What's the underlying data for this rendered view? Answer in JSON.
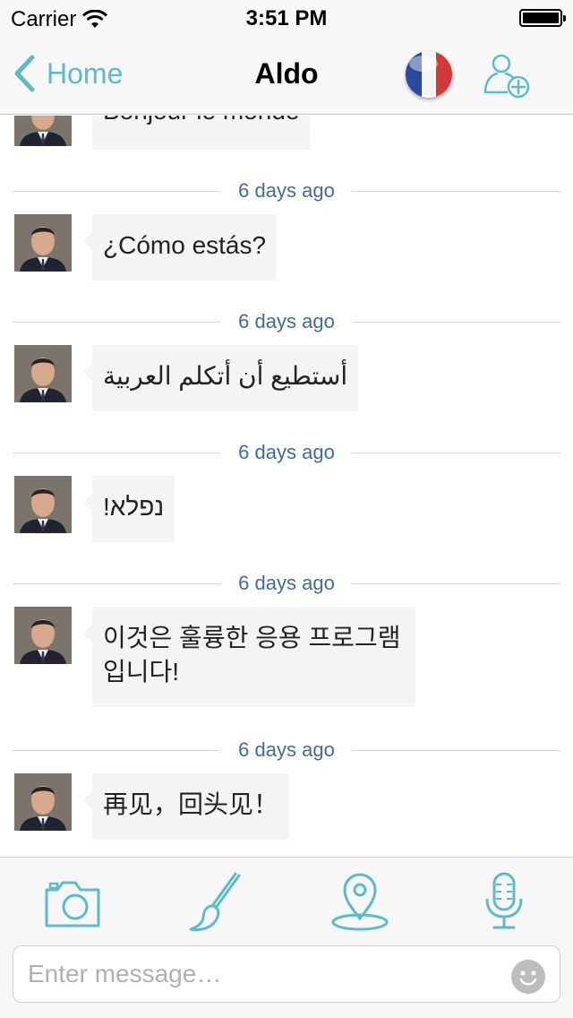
{
  "status": {
    "carrier": "Carrier",
    "time": "3:51 PM"
  },
  "nav": {
    "back_label": "Home",
    "title": "Aldo"
  },
  "messages": [
    {
      "text": "Bonjour le monde",
      "time": ""
    },
    {
      "text": "¿Cómo estás?",
      "time": "6 days ago"
    },
    {
      "text": "أستطيع أن أتكلم العربية",
      "time": "6 days ago"
    },
    {
      "text": "נפלא!",
      "time": "6 days ago"
    },
    {
      "text": "이것은 훌륭한 응용 프로그램입니다!",
      "time": "6 days ago"
    },
    {
      "text": "再见，回头见！",
      "time": "6 days ago"
    }
  ],
  "composer": {
    "placeholder": "Enter message…"
  },
  "icons": {
    "accent": "#5bbcc7",
    "tools": [
      "camera-icon",
      "brush-icon",
      "location-pin-icon",
      "microphone-icon"
    ]
  }
}
